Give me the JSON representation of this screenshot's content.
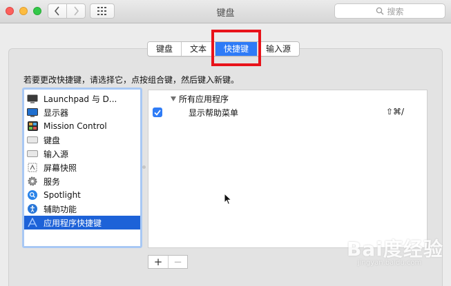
{
  "window": {
    "title": "键盘",
    "search_placeholder": "搜索"
  },
  "tabs": [
    {
      "label": "键盘",
      "active": false
    },
    {
      "label": "文本",
      "active": false
    },
    {
      "label": "快捷键",
      "active": true
    },
    {
      "label": "输入源",
      "active": false
    }
  ],
  "instruction": "若要更改快捷键，请选择它，点按组合键，然后键入新键。",
  "categories": [
    {
      "label": "Launchpad 与 D...",
      "icon": "launchpad-icon",
      "selected": false
    },
    {
      "label": "显示器",
      "icon": "display-icon",
      "selected": false
    },
    {
      "label": "Mission Control",
      "icon": "mission-control-icon",
      "selected": false
    },
    {
      "label": "键盘",
      "icon": "keyboard-icon",
      "selected": false
    },
    {
      "label": "输入源",
      "icon": "input-source-icon",
      "selected": false
    },
    {
      "label": "屏幕快照",
      "icon": "screenshot-icon",
      "selected": false
    },
    {
      "label": "服务",
      "icon": "services-gear-icon",
      "selected": false
    },
    {
      "label": "Spotlight",
      "icon": "spotlight-icon",
      "selected": false
    },
    {
      "label": "辅助功能",
      "icon": "accessibility-icon",
      "selected": false
    },
    {
      "label": "应用程序快捷键",
      "icon": "app-shortcuts-icon",
      "selected": true
    }
  ],
  "shortcuts": {
    "group_label": "所有应用程序",
    "rows": [
      {
        "label": "显示帮助菜单",
        "keys": "⇧⌘/",
        "checked": true
      }
    ]
  },
  "buttons": {
    "add": "+",
    "remove": "−"
  },
  "watermark": {
    "brand": "Bai度经验",
    "url": "jingyan.baidu.com"
  },
  "colors": {
    "accent": "#2e7bf7",
    "selection": "#1d62d8",
    "annotation_red": "#e8131a"
  }
}
